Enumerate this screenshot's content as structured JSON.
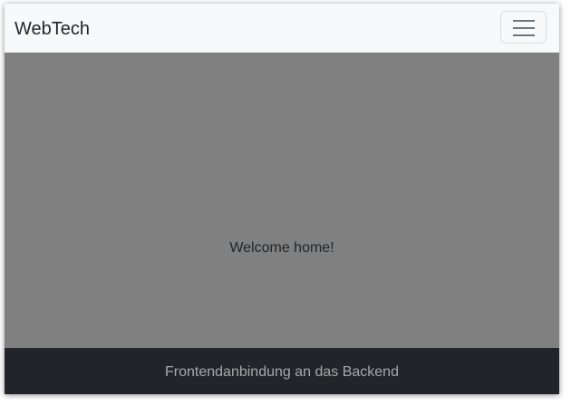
{
  "navbar": {
    "brand": "WebTech",
    "toggler_icon": "hamburger-menu-icon"
  },
  "main": {
    "welcome_text": "Welcome home!",
    "background_color": "#808080"
  },
  "footer": {
    "text": "Frontendanbindung an das Backend",
    "background_color": "#212529"
  }
}
